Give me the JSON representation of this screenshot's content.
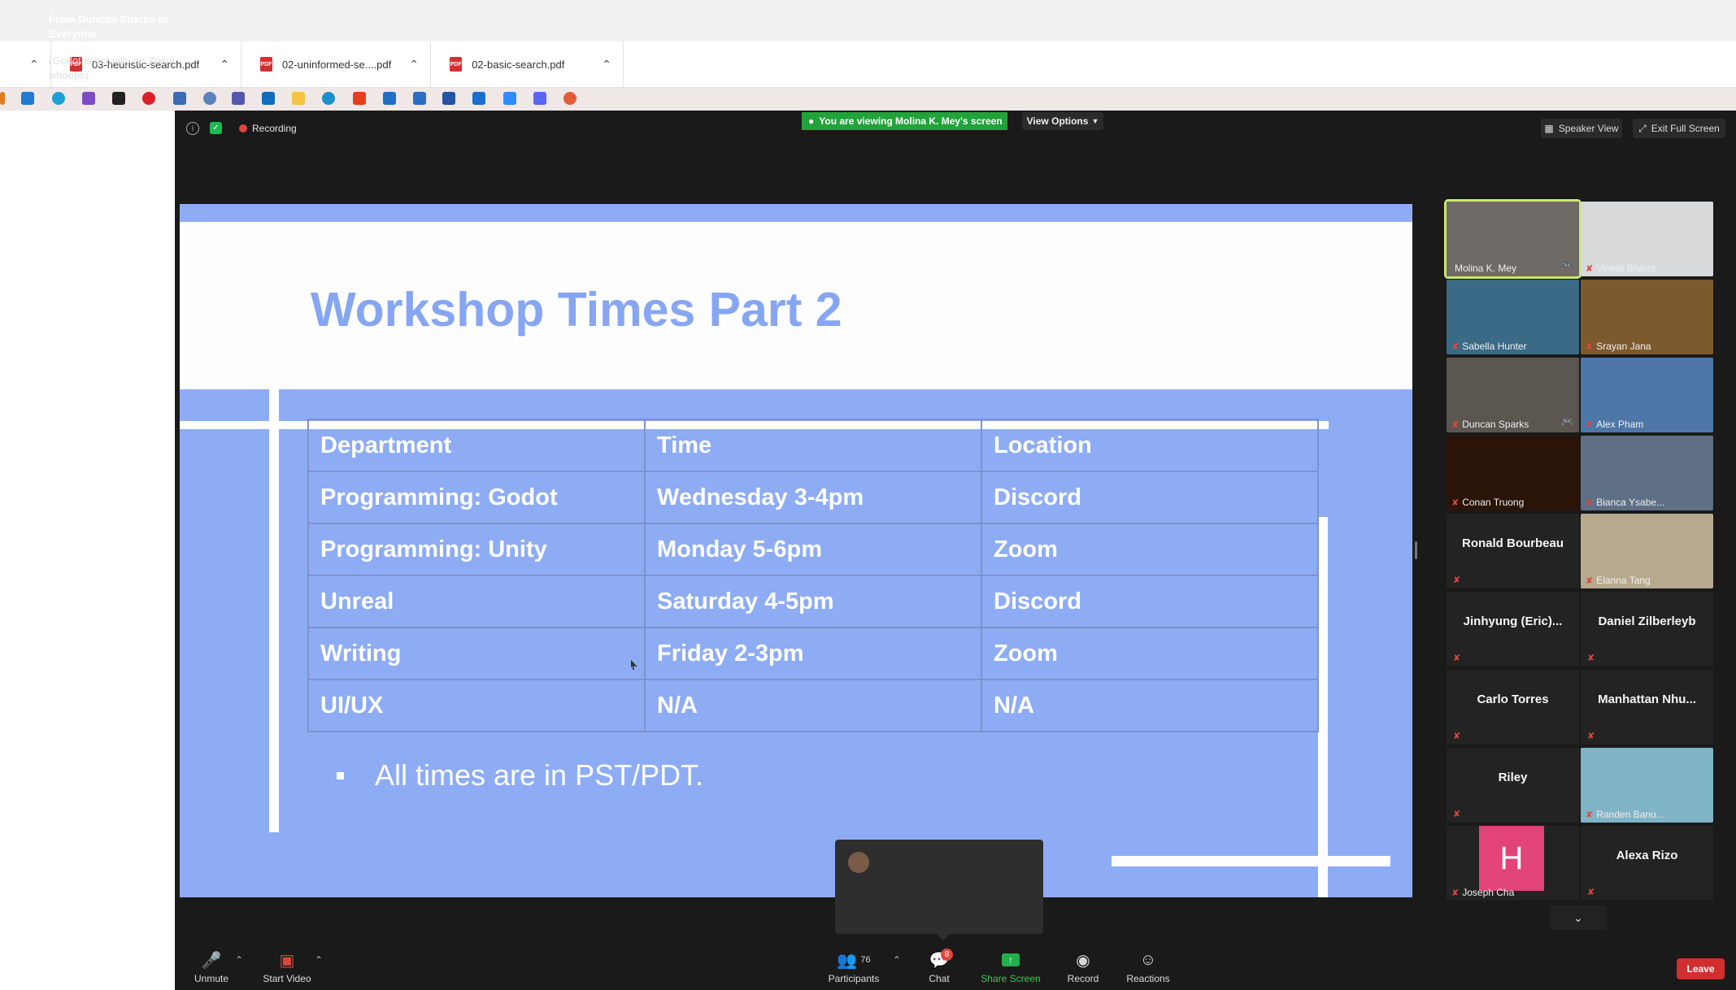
{
  "downloads": [
    {
      "name": "03-heuristic-search.pdf"
    },
    {
      "name": "02-uninformed-se....pdf"
    },
    {
      "name": "02-basic-search.pdf"
    }
  ],
  "pdf_badge": "PDF",
  "zoom": {
    "recording_label": "Recording",
    "viewing_banner": "You are viewing Molina K. Mey's screen",
    "view_options": "View Options",
    "speaker_view": "Speaker View",
    "exit_full_screen": "Exit Full Screen"
  },
  "slide": {
    "title": "Workshop Times Part 2",
    "table": {
      "headers": [
        "Department",
        "Time",
        "Location"
      ],
      "rows": [
        [
          "Programming: Godot",
          "Wednesday 3-4pm",
          "Discord"
        ],
        [
          "Programming: Unity",
          "Monday 5-6pm",
          "Zoom"
        ],
        [
          "Unreal",
          "Saturday 4-5pm",
          "Discord"
        ],
        [
          "Writing",
          "Friday 2-3pm",
          "Zoom"
        ],
        [
          "UI/UX",
          "N/A",
          "N/A"
        ]
      ]
    },
    "bullet": "All times are in PST/PDT."
  },
  "participants": [
    {
      "name": "Molina K. Mey",
      "mode": "video",
      "color": "#6f6a66",
      "active": true
    },
    {
      "name": "Vineet Bharot",
      "mode": "video",
      "color": "#d9dadc"
    },
    {
      "name": "Sabella Hunter",
      "mode": "video",
      "color": "#3a6a86"
    },
    {
      "name": "Srayan Jana",
      "mode": "video",
      "color": "#7d5a2e"
    },
    {
      "name": "Duncan Sparks",
      "mode": "video",
      "color": "#5b5650"
    },
    {
      "name": "Alex Pham",
      "mode": "video",
      "color": "#4e77a8"
    },
    {
      "name": "Conan Truong",
      "mode": "video",
      "color": "#2a1408"
    },
    {
      "name": "Bianca Ysabe...",
      "mode": "video",
      "color": "#5e6f86"
    },
    {
      "name": "Ronald Bourbeau",
      "mode": "name"
    },
    {
      "name": "Elanna Tang",
      "mode": "video",
      "color": "#b7a98e"
    },
    {
      "name": "Jinhyung  (Eric)...",
      "mode": "name"
    },
    {
      "name": "Daniel Zilberleyb",
      "mode": "name"
    },
    {
      "name": "Carlo Torres",
      "mode": "name"
    },
    {
      "name": "Manhattan  Nhu...",
      "mode": "name"
    },
    {
      "name": "Riley",
      "mode": "name"
    },
    {
      "name": "Randen Banu...",
      "mode": "video",
      "color": "#7fb4c6"
    },
    {
      "name": "Joseph Cha",
      "mode": "avatar",
      "initial": "H"
    },
    {
      "name": "Alexa Rizo",
      "mode": "name"
    }
  ],
  "chat_toast": {
    "title": "From Duncan Sparks to Everyone",
    "message": "(Godot is actually on Zoom whoops)"
  },
  "controls": {
    "unmute": "Unmute",
    "start_video": "Start Video",
    "participants": "Participants",
    "participants_count": "76",
    "chat": "Chat",
    "chat_badge": "8",
    "share_screen": "Share Screen",
    "record": "Record",
    "reactions": "Reactions",
    "leave": "Leave"
  }
}
